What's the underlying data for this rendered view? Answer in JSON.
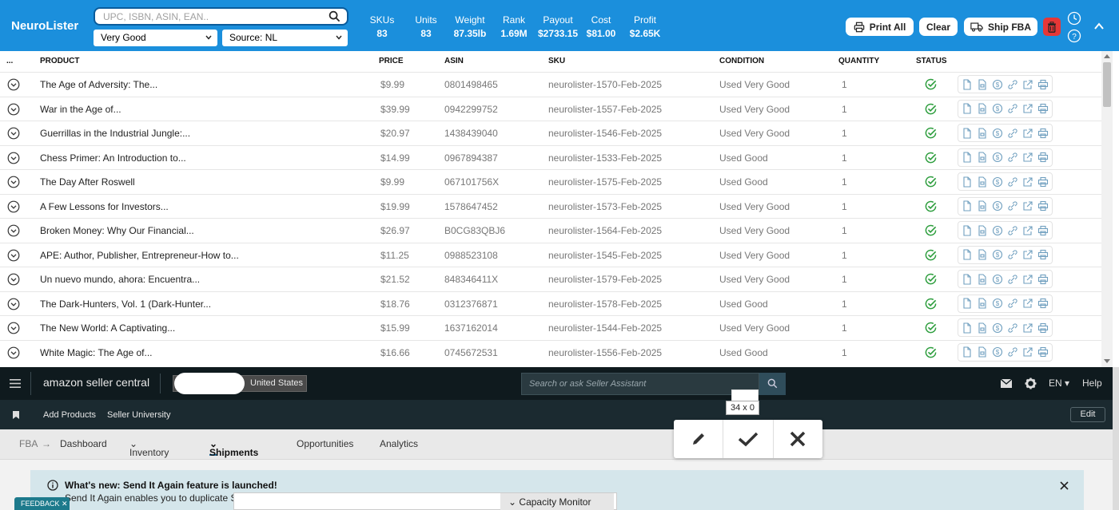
{
  "header": {
    "brand": "NeuroLister",
    "search_placeholder": "UPC, ISBN, ASIN, EAN..",
    "condition_select": "Very Good",
    "source_select": "Source: NL",
    "stats": [
      {
        "label": "SKUs",
        "value": "83"
      },
      {
        "label": "Units",
        "value": "83"
      },
      {
        "label": "Weight",
        "value": "87.35lb"
      },
      {
        "label": "Rank",
        "value": "1.69M"
      },
      {
        "label": "Payout",
        "value": "$2733.15"
      },
      {
        "label": "Cost",
        "value": "$81.00"
      },
      {
        "label": "Profit",
        "value": "$2.65K"
      }
    ],
    "print_all": "Print All",
    "clear": "Clear",
    "ship_fba": "Ship FBA"
  },
  "table": {
    "columns": [
      "...",
      "PRODUCT",
      "PRICE",
      "ASIN",
      "SKU",
      "CONDITION",
      "QUANTITY",
      "STATUS"
    ],
    "rows": [
      {
        "product": "The Age of Adversity: The...",
        "price": "$9.99",
        "asin": "0801498465",
        "sku": "neurolister-1570-Feb-2025",
        "condition": "Used Very Good",
        "qty": "1"
      },
      {
        "product": "War in the Age of...",
        "price": "$39.99",
        "asin": "0942299752",
        "sku": "neurolister-1557-Feb-2025",
        "condition": "Used Very Good",
        "qty": "1"
      },
      {
        "product": "Guerrillas in the Industrial Jungle:...",
        "price": "$20.97",
        "asin": "1438439040",
        "sku": "neurolister-1546-Feb-2025",
        "condition": "Used Very Good",
        "qty": "1"
      },
      {
        "product": "Chess Primer: An Introduction to...",
        "price": "$14.99",
        "asin": "0967894387",
        "sku": "neurolister-1533-Feb-2025",
        "condition": "Used Good",
        "qty": "1"
      },
      {
        "product": "The Day After Roswell",
        "price": "$9.99",
        "asin": "067101756X",
        "sku": "neurolister-1575-Feb-2025",
        "condition": "Used Good",
        "qty": "1"
      },
      {
        "product": "A Few Lessons for Investors...",
        "price": "$19.99",
        "asin": "1578647452",
        "sku": "neurolister-1573-Feb-2025",
        "condition": "Used Very Good",
        "qty": "1"
      },
      {
        "product": "Broken Money: Why Our Financial...",
        "price": "$26.97",
        "asin": "B0CG83QBJ6",
        "sku": "neurolister-1564-Feb-2025",
        "condition": "Used Very Good",
        "qty": "1"
      },
      {
        "product": "APE: Author, Publisher, Entrepreneur-How to...",
        "price": "$11.25",
        "asin": "0988523108",
        "sku": "neurolister-1545-Feb-2025",
        "condition": "Used Very Good",
        "qty": "1"
      },
      {
        "product": "Un nuevo mundo, ahora: Encuentra...",
        "price": "$21.52",
        "asin": "848346411X",
        "sku": "neurolister-1579-Feb-2025",
        "condition": "Used Very Good",
        "qty": "1"
      },
      {
        "product": "The Dark-Hunters, Vol. 1 (Dark-Hunter...",
        "price": "$18.76",
        "asin": "0312376871",
        "sku": "neurolister-1578-Feb-2025",
        "condition": "Used Good",
        "qty": "1"
      },
      {
        "product": "The New World: A Captivating...",
        "price": "$15.99",
        "asin": "1637162014",
        "sku": "neurolister-1544-Feb-2025",
        "condition": "Used Very Good",
        "qty": "1"
      },
      {
        "product": "White Magic: The Age of...",
        "price": "$16.66",
        "asin": "0745672531",
        "sku": "neurolister-1556-Feb-2025",
        "condition": "Used Good",
        "qty": "1"
      }
    ]
  },
  "amazon": {
    "logo": "amazon seller central",
    "marketplace": "United States",
    "search_placeholder": "Search or ask Seller Assistant",
    "lang": "EN",
    "help": "Help",
    "bookmarks": [
      "Add Products",
      "Seller University"
    ],
    "edit": "Edit",
    "nav": {
      "fba": "FBA",
      "dashboard": "Dashboard",
      "inventory": "Inventory",
      "shipments": "Shipments",
      "opportunities": "Opportunities",
      "analytics": "Analytics"
    },
    "banner_title": "What's new: Send It Again feature is launched!",
    "banner_text": "Send It Again enables you to duplicate S",
    "capacity": "Capacity Monitor",
    "feedback": "FEEDBACK"
  },
  "overlay": {
    "size_label": "34 x 0"
  },
  "colors": {
    "header_bg": "#1b8fdc",
    "status_ok": "#2e9e3e",
    "amazon_dark": "#0f1a1e",
    "trash": "#e63737"
  }
}
